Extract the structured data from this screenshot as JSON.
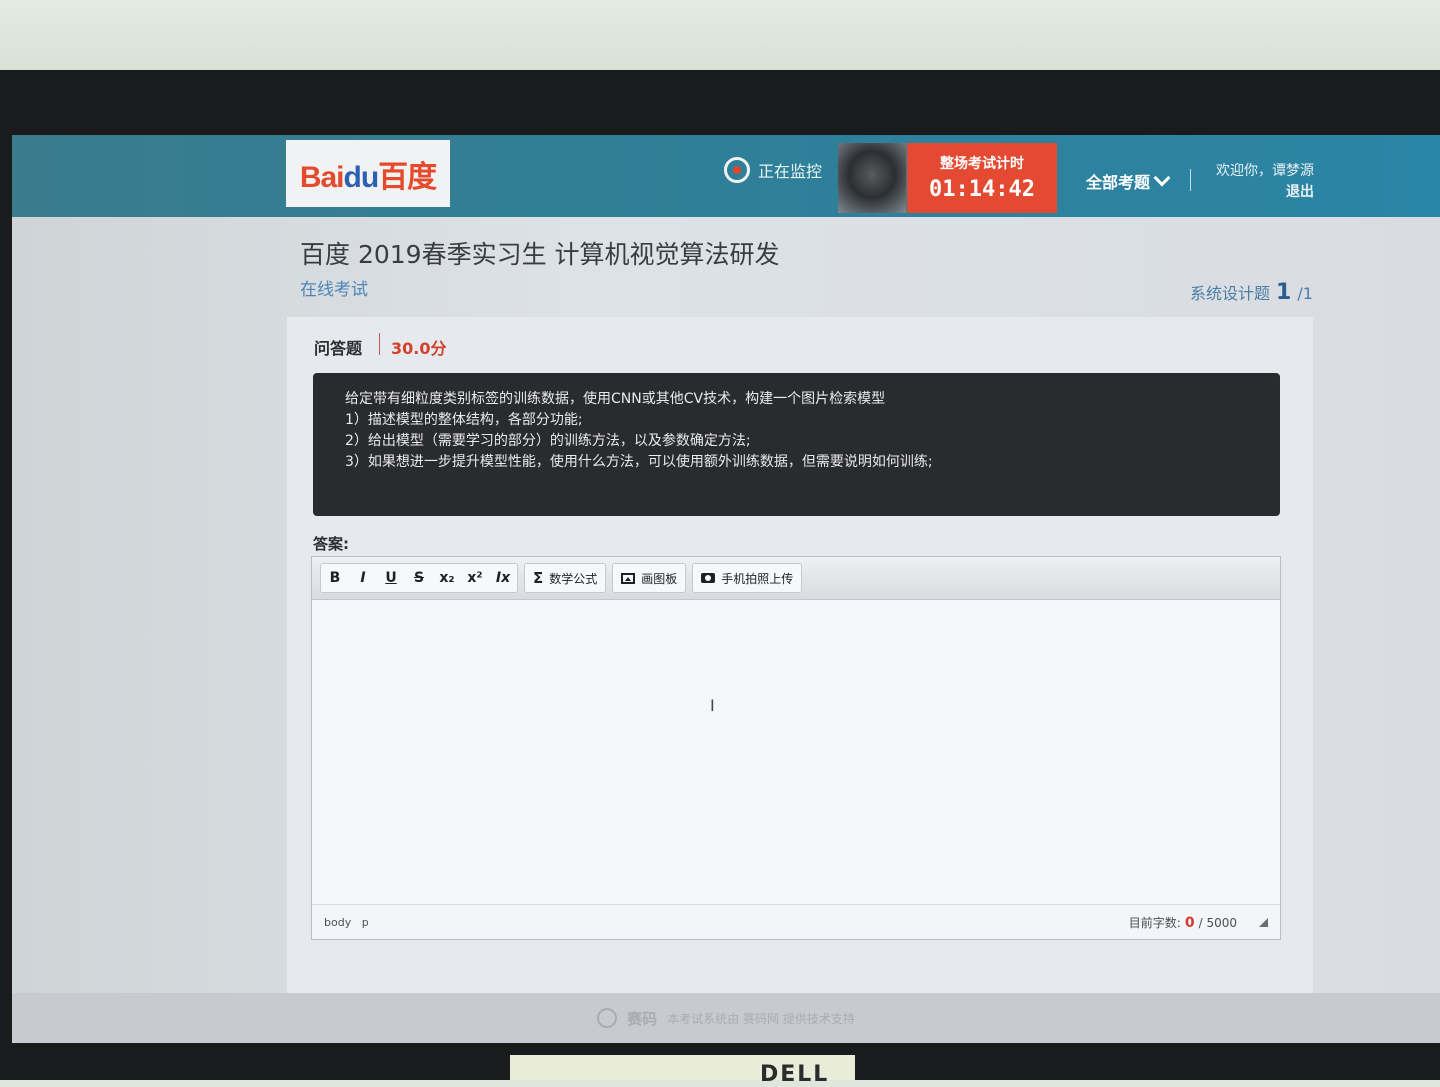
{
  "header": {
    "logo_text_latin": "Bai",
    "logo_text_du": "du",
    "logo_text_cn": "百度",
    "monitoring_label": "正在监控",
    "timer_label": "整场考试计时",
    "timer_value": "01:14:42",
    "all_questions_label": "全部考题",
    "welcome_text": "欢迎你，谭梦源",
    "logout_label": "退出"
  },
  "page": {
    "title": "百度 2019春季实习生 计算机视觉算法研发",
    "subtitle": "在线考试",
    "section_label": "系统设计题",
    "question_index": "1",
    "question_total": "/1"
  },
  "question": {
    "type": "问答题",
    "score": "30.0分",
    "lines": [
      "给定带有细粒度类别标签的训练数据，使用CNN或其他CV技术，构建一个图片检索模型",
      "1）描述模型的整体结构，各部分功能;",
      "2）给出模型（需要学习的部分）的训练方法，以及参数确定方法;",
      "3）如果想进一步提升模型性能，使用什么方法，可以使用额外训练数据，但需要说明如何训练;"
    ]
  },
  "answer": {
    "label": "答案:",
    "toolbar": {
      "bold": "B",
      "italic": "I",
      "underline": "U",
      "strike": "S",
      "subscript": "x₂",
      "superscript": "x²",
      "clear_format": "Ix",
      "formula_icon": "Σ",
      "formula": "数学公式",
      "drawing_board": "画图板",
      "photo_upload": "手机拍照上传"
    },
    "path_body": "body",
    "path_p": "p",
    "word_count_label": "目前字数:",
    "word_count": "0",
    "word_limit": "/ 5000"
  },
  "footer": {
    "brand": "赛码",
    "text": "本考试系统由 赛码网 提供技术支持"
  },
  "bezel_brand": "DELL",
  "colors": {
    "topbar": "#2f7f98",
    "timer_bg": "#e44a32",
    "score": "#d2412c",
    "question_bg": "#2a2b2e"
  }
}
